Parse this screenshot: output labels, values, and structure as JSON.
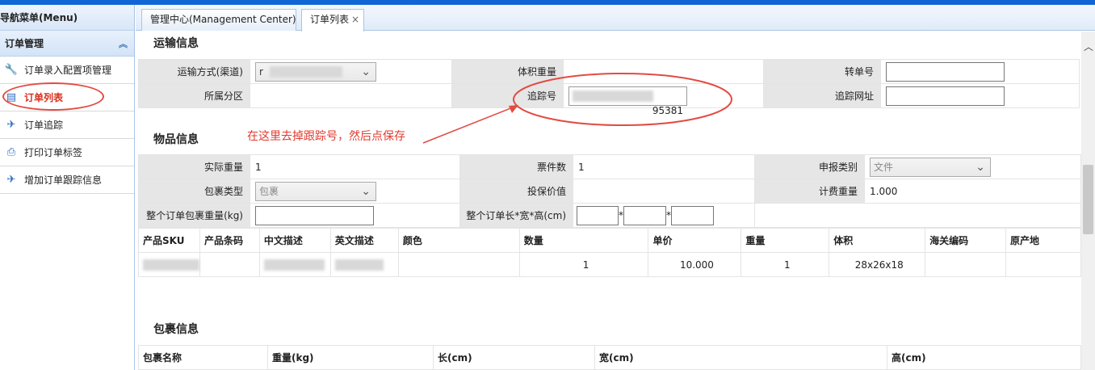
{
  "sidebar": {
    "title": "导航菜单(Menu)",
    "group": "订单管理",
    "items": [
      {
        "label": "订单录入配置项管理",
        "icon": "wrench-icon"
      },
      {
        "label": "订单列表",
        "icon": "list-icon"
      },
      {
        "label": "订单追踪",
        "icon": "airplane-icon"
      },
      {
        "label": "打印订单标签",
        "icon": "printer-icon"
      },
      {
        "label": "增加订单跟踪信息",
        "icon": "airplane-icon"
      }
    ]
  },
  "tabs": [
    {
      "label": "管理中心(Management Center)"
    },
    {
      "label": "订单列表",
      "close": "×"
    }
  ],
  "shipping": {
    "title": "运输信息",
    "method_label": "运输方式(渠道)",
    "method_value": "r",
    "volume_weight_label": "体积重量",
    "transfer_label": "转单号",
    "zone_label": "所属分区",
    "tracking_label": "追踪号",
    "tracking_value": "95381",
    "tracking_url_label": "追踪网址"
  },
  "annotation": "在这里去掉跟踪号，然后点保存",
  "goods": {
    "title": "物品信息",
    "actual_weight_label": "实际重量",
    "actual_weight": "1",
    "pieces_label": "票件数",
    "pieces": "1",
    "declare_label": "申报类别",
    "declare_value": "文件",
    "package_type_label": "包裹类型",
    "package_type_value": "包裹",
    "insured_label": "投保价值",
    "billing_weight_label": "计费重量",
    "billing_weight": "1.000",
    "total_pkg_weight_label": "整个订单包裹重量(kg)",
    "dims_label": "整个订单长*宽*高(cm)",
    "star": "*"
  },
  "products": {
    "headers": [
      "产品SKU",
      "产品条码",
      "中文描述",
      "英文描述",
      "颜色",
      "数量",
      "单价",
      "重量",
      "体积",
      "海关编码",
      "原产地"
    ],
    "row": {
      "qty": "1",
      "price": "10.000",
      "weight": "1",
      "volume": "28x26x18"
    }
  },
  "package": {
    "title": "包裹信息",
    "headers": [
      "包裹名称",
      "重量(kg)",
      "长(cm)",
      "宽(cm)",
      "高(cm)"
    ]
  },
  "colors": {
    "accent": "#1166d6",
    "annotation": "#e03b2f"
  }
}
